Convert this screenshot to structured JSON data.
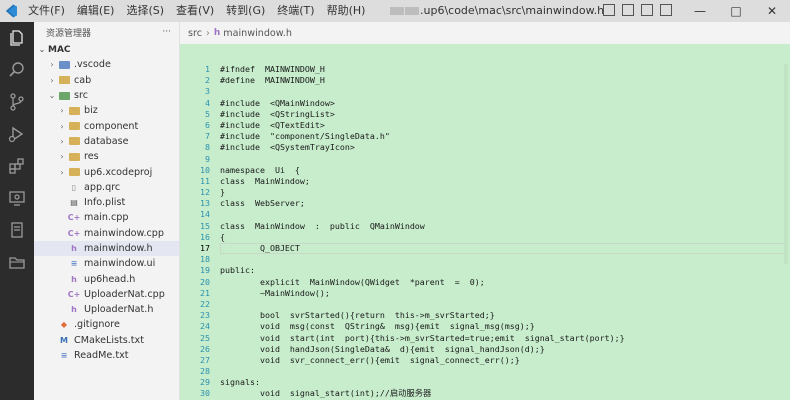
{
  "titlebar": {
    "menu": [
      "文件(F)",
      "编辑(E)",
      "选择(S)",
      "查看(V)",
      "转到(G)",
      "终端(T)",
      "帮助(H)"
    ],
    "window_title": ".up6\\code\\mac\\src\\mainwindow.h",
    "controls": [
      "—",
      "□",
      "✕"
    ]
  },
  "activity": [
    "explorer-icon",
    "search-icon",
    "source-control-icon",
    "run-debug-icon",
    "extensions-icon",
    "remote-icon",
    "book-icon",
    "folder-icon"
  ],
  "sidebar": {
    "title": "资源管理器",
    "more": "···",
    "tree": [
      {
        "label": "MAC",
        "depth": 0,
        "chev": "⌄",
        "kind": "root"
      },
      {
        "label": ".vscode",
        "depth": 1,
        "chev": "›",
        "kind": "folder-blue"
      },
      {
        "label": "cab",
        "depth": 1,
        "chev": "›",
        "kind": "folder"
      },
      {
        "label": "src",
        "depth": 1,
        "chev": "⌄",
        "kind": "folder-green"
      },
      {
        "label": "biz",
        "depth": 2,
        "chev": "›",
        "kind": "folder"
      },
      {
        "label": "component",
        "depth": 2,
        "chev": "›",
        "kind": "folder"
      },
      {
        "label": "database",
        "depth": 2,
        "chev": "›",
        "kind": "folder"
      },
      {
        "label": "res",
        "depth": 2,
        "chev": "›",
        "kind": "folder"
      },
      {
        "label": "up6.xcodeproj",
        "depth": 2,
        "chev": "›",
        "kind": "folder"
      },
      {
        "label": "app.qrc",
        "depth": 2,
        "chev": "",
        "kind": "file"
      },
      {
        "label": "Info.plist",
        "depth": 2,
        "chev": "",
        "kind": "plist"
      },
      {
        "label": "main.cpp",
        "depth": 2,
        "chev": "",
        "kind": "cpp"
      },
      {
        "label": "mainwindow.cpp",
        "depth": 2,
        "chev": "",
        "kind": "cpp"
      },
      {
        "label": "mainwindow.h",
        "depth": 2,
        "chev": "",
        "kind": "h",
        "selected": true
      },
      {
        "label": "mainwindow.ui",
        "depth": 2,
        "chev": "",
        "kind": "ui"
      },
      {
        "label": "up6head.h",
        "depth": 2,
        "chev": "",
        "kind": "h"
      },
      {
        "label": "UploaderNat.cpp",
        "depth": 2,
        "chev": "",
        "kind": "cpp"
      },
      {
        "label": "UploaderNat.h",
        "depth": 2,
        "chev": "",
        "kind": "h"
      },
      {
        "label": ".gitignore",
        "depth": 1,
        "chev": "",
        "kind": "git"
      },
      {
        "label": "CMakeLists.txt",
        "depth": 1,
        "chev": "",
        "kind": "cmake"
      },
      {
        "label": "ReadMe.txt",
        "depth": 1,
        "chev": "",
        "kind": "txt"
      }
    ]
  },
  "editor": {
    "breadcrumb": [
      "src",
      "mainwindow.h"
    ],
    "breadcrumb_icon": "h",
    "lines": [
      {
        "n": "1",
        "t": "#ifndef  MAINWINDOW_H"
      },
      {
        "n": "2",
        "t": "#define  MAINWINDOW_H"
      },
      {
        "n": "3",
        "t": ""
      },
      {
        "n": "4",
        "t": "#include  <QMainWindow>"
      },
      {
        "n": "5",
        "t": "#include  <QStringList>"
      },
      {
        "n": "6",
        "t": "#include  <QTextEdit>"
      },
      {
        "n": "7",
        "t": "#include  \"component/SingleData.h\""
      },
      {
        "n": "8",
        "t": "#include  <QSystemTrayIcon>"
      },
      {
        "n": "9",
        "t": ""
      },
      {
        "n": "10",
        "t": "namespace  Ui  {"
      },
      {
        "n": "11",
        "t": "class  MainWindow;"
      },
      {
        "n": "12",
        "t": "}"
      },
      {
        "n": "13",
        "t": "class  WebServer;"
      },
      {
        "n": "14",
        "t": ""
      },
      {
        "n": "15",
        "t": "class  MainWindow  :  public  QMainWindow"
      },
      {
        "n": "16",
        "t": "{"
      },
      {
        "n": "17",
        "t": "        Q_OBJECT"
      },
      {
        "n": "18",
        "t": ""
      },
      {
        "n": "19",
        "t": "public:"
      },
      {
        "n": "20",
        "t": "        explicit  MainWindow(QWidget  *parent  =  0);"
      },
      {
        "n": "21",
        "t": "        ~MainWindow();"
      },
      {
        "n": "22",
        "t": ""
      },
      {
        "n": "23",
        "t": "        bool  svrStarted(){return  this->m_svrStarted;}"
      },
      {
        "n": "24",
        "t": "        void  msg(const  QString&  msg){emit  signal_msg(msg);}"
      },
      {
        "n": "25",
        "t": "        void  start(int  port){this->m_svrStarted=true;emit  signal_start(port);}"
      },
      {
        "n": "26",
        "t": "        void  handJson(SingleData&  d){emit  signal_handJson(d);}"
      },
      {
        "n": "27",
        "t": "        void  svr_connect_err(){emit  signal_connect_err();}"
      },
      {
        "n": "28",
        "t": ""
      },
      {
        "n": "29",
        "t": "signals:"
      },
      {
        "n": "30",
        "t": "        void  signal_start(int);//启动服务器"
      }
    ],
    "active_line": "17"
  },
  "colors": {
    "editor_bg": "#c7edcc",
    "activity_bg": "#2c2c2c",
    "sidebar_bg": "#f3f3f3",
    "titlebar_bg": "#dddddd"
  }
}
